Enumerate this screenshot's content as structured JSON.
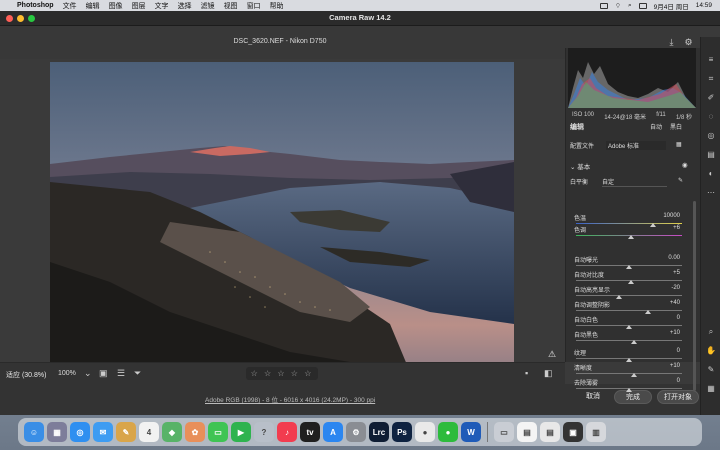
{
  "menubar": {
    "app": "Photoshop",
    "items": [
      "文件",
      "编辑",
      "图像",
      "图层",
      "文字",
      "选择",
      "滤镜",
      "视图",
      "窗口",
      "帮助"
    ],
    "clock": "9月4日 周日",
    "time": "14:59"
  },
  "window": {
    "title": "Camera Raw 14.2",
    "file_title": "DSC_3620.NEF  -  Nikon D750"
  },
  "camera": {
    "iso": "ISO 100",
    "lens": "14-24@18 毫米",
    "aperture": "f/11",
    "shutter": "1/8 秒"
  },
  "panel": {
    "edit_title": "编辑",
    "auto": "自动",
    "bw": "黑白",
    "profile_label": "配置文件",
    "profile_value": "Adobe 标准",
    "section_basic": "基本",
    "wb_label": "白平衡",
    "wb_value": "自定"
  },
  "sliders": [
    {
      "label": "色温",
      "value": "10000",
      "pos": 0.73
    },
    {
      "label": "色调",
      "value": "+6",
      "pos": 0.52
    },
    {
      "label": "自动曝光",
      "value": "0.00",
      "pos": 0.5
    },
    {
      "label": "自动对比度",
      "value": "+5",
      "pos": 0.52
    },
    {
      "label": "自动高亮显示",
      "value": "-20",
      "pos": 0.41
    },
    {
      "label": "自动调整阴影",
      "value": "+40",
      "pos": 0.68
    },
    {
      "label": "自动白色",
      "value": "0",
      "pos": 0.5
    },
    {
      "label": "自动黑色",
      "value": "+10",
      "pos": 0.55
    },
    {
      "label": "纹理",
      "value": "0",
      "pos": 0.5
    },
    {
      "label": "清晰度",
      "value": "+10",
      "pos": 0.55
    },
    {
      "label": "去除薄雾",
      "value": "0",
      "pos": 0.5
    }
  ],
  "bottombar": {
    "fit": "适应 (30.8%)",
    "zoom": "100%",
    "stars": "☆ ☆ ☆ ☆ ☆"
  },
  "footer": {
    "info": "Adobe RGB (1998) - 8 位 - 6016 x 4016 (24.2MP) - 300 ppi",
    "cancel": "取消",
    "done": "完成",
    "open": "打开对象"
  },
  "dock": [
    {
      "name": "finder",
      "label": "☺",
      "color": "#3a8ee6"
    },
    {
      "name": "launchpad",
      "label": "▦",
      "color": "#7d7d9a"
    },
    {
      "name": "safari",
      "label": "◎",
      "color": "#2f8ff0"
    },
    {
      "name": "mail",
      "label": "✉",
      "color": "#3d9cf2"
    },
    {
      "name": "notes-app",
      "label": "✎",
      "color": "#d9a54a"
    },
    {
      "name": "calendar",
      "label": "4",
      "color": "#f2f2f2"
    },
    {
      "name": "maps",
      "label": "◆",
      "color": "#58b368"
    },
    {
      "name": "photos",
      "label": "✿",
      "color": "#e88f5a"
    },
    {
      "name": "messages",
      "label": "▭",
      "color": "#3fc454"
    },
    {
      "name": "facetime",
      "label": "▶",
      "color": "#2fb34f"
    },
    {
      "name": "tips",
      "label": "?",
      "color": "#b8bfc9"
    },
    {
      "name": "music",
      "label": "♪",
      "color": "#f23c4f"
    },
    {
      "name": "tv",
      "label": "tv",
      "color": "#1f1f1f"
    },
    {
      "name": "app-store",
      "label": "A",
      "color": "#2b86f0"
    },
    {
      "name": "settings",
      "label": "⚙",
      "color": "#8a8d93"
    },
    {
      "name": "lightroom",
      "label": "Lrc",
      "color": "#0f1d33"
    },
    {
      "name": "photoshop",
      "label": "Ps",
      "color": "#0e2240"
    },
    {
      "name": "chrome",
      "label": "●",
      "color": "#e9e9e9"
    },
    {
      "name": "wechat",
      "label": "●",
      "color": "#2dbb3c"
    },
    {
      "name": "word",
      "label": "W",
      "color": "#1f5bb8"
    },
    {
      "name": "preview",
      "label": "▭",
      "color": "#c9cdd4"
    },
    {
      "name": "document",
      "label": "▤",
      "color": "#f4f4f4"
    },
    {
      "name": "document-2",
      "label": "▤",
      "color": "#e8e8e8"
    },
    {
      "name": "screen-app",
      "label": "▣",
      "color": "#333"
    },
    {
      "name": "trash",
      "label": "▥",
      "color": "#d6d8dc"
    }
  ]
}
